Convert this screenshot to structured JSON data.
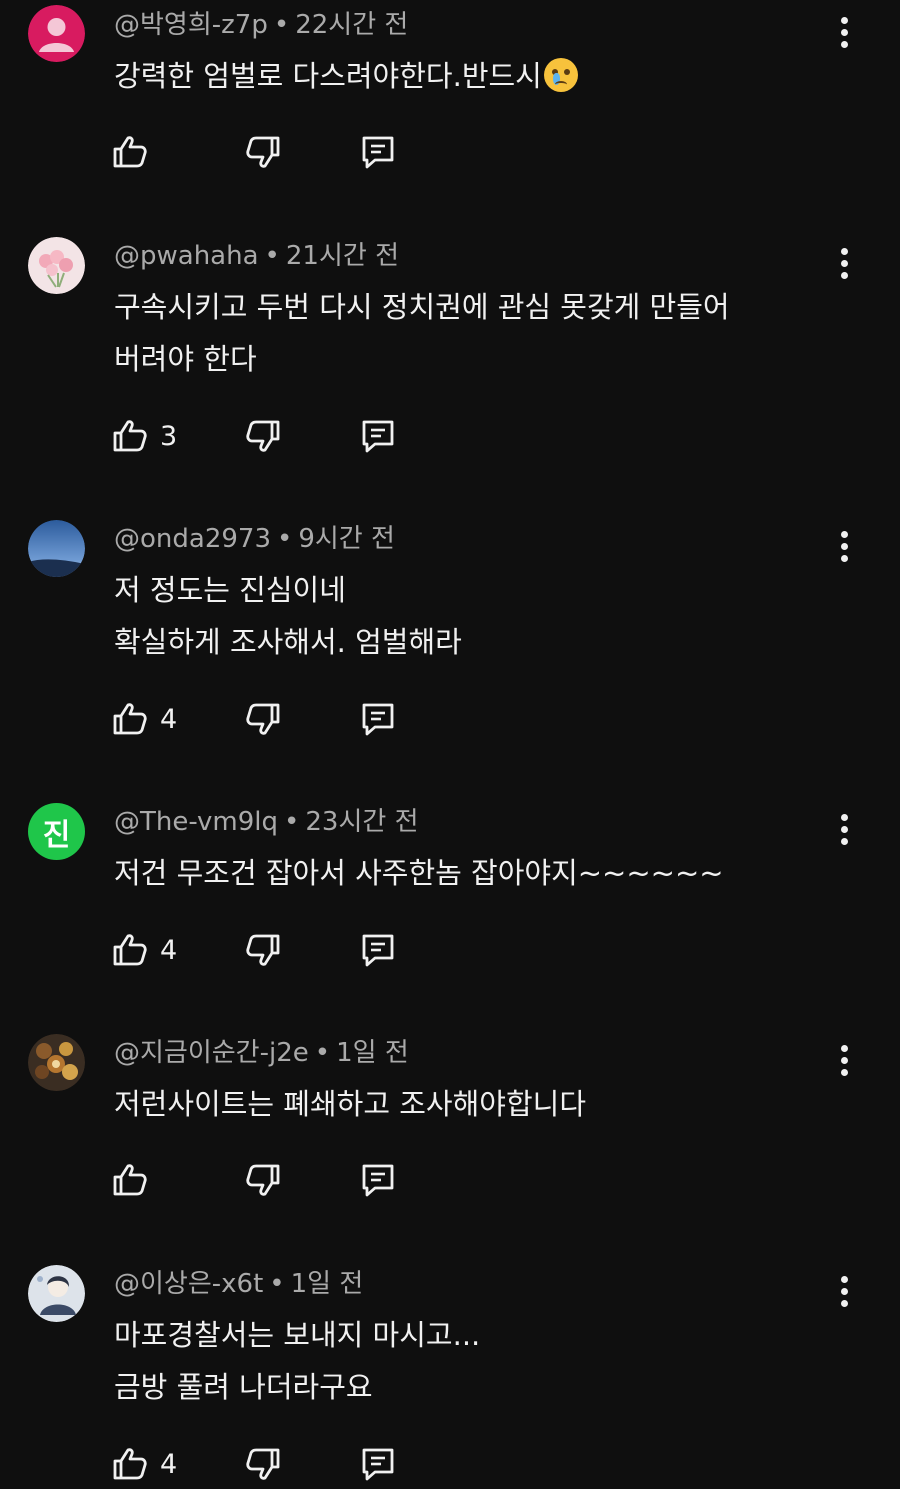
{
  "comments": [
    {
      "author": "@박영희-z7p",
      "time": "22시간 전",
      "lines": [
        "강력한 엄벌로 다스려야한다.반드시"
      ],
      "emoji": "crying-face",
      "likes": "",
      "avatar": {
        "kind": "default-user",
        "bg": "#d81b60"
      }
    },
    {
      "author": "@pwahaha",
      "time": "21시간 전",
      "lines": [
        "구속시키고 두번 다시 정치권에 관심 못갖게 만들어",
        "버려야 한다"
      ],
      "likes": "3",
      "avatar": {
        "kind": "photo-flowers",
        "bg": "#f3e4e6"
      }
    },
    {
      "author": "@onda2973",
      "time": "9시간 전",
      "lines": [
        "저 정도는 진심이네",
        "확실하게 조사해서. 엄벌해라"
      ],
      "likes": "4",
      "avatar": {
        "kind": "photo-sky",
        "bg": "#3d6fae"
      }
    },
    {
      "author": "@The-vm9lq",
      "time": "23시간 전",
      "lines": [
        "저건 무조건 잡아서 사주한놈 잡아야지~~~~~~"
      ],
      "likes": "4",
      "avatar": {
        "kind": "letter",
        "letter": "진",
        "bg": "#1fc64a"
      }
    },
    {
      "author": "@지금이순간-j2e",
      "time": "1일 전",
      "lines": [
        "저런사이트는 폐쇄하고 조사해야합니다"
      ],
      "likes": "",
      "avatar": {
        "kind": "photo-food",
        "bg": "#3a2d22"
      }
    },
    {
      "author": "@이상은-x6t",
      "time": "1일 전",
      "lines": [
        "마포경찰서는 보내지 마시고...",
        "금방 풀려 나더라구요"
      ],
      "likes": "4",
      "avatar": {
        "kind": "photo-illustration",
        "bg": "#dde3ea"
      }
    }
  ],
  "icons": {
    "like": "thumbs-up-icon",
    "dislike": "thumbs-down-icon",
    "reply": "reply-icon",
    "more": "more-vert-icon"
  },
  "colors": {
    "background": "#0f0f0f",
    "text": "#f1f1f1",
    "meta": "#aaaaaa"
  }
}
